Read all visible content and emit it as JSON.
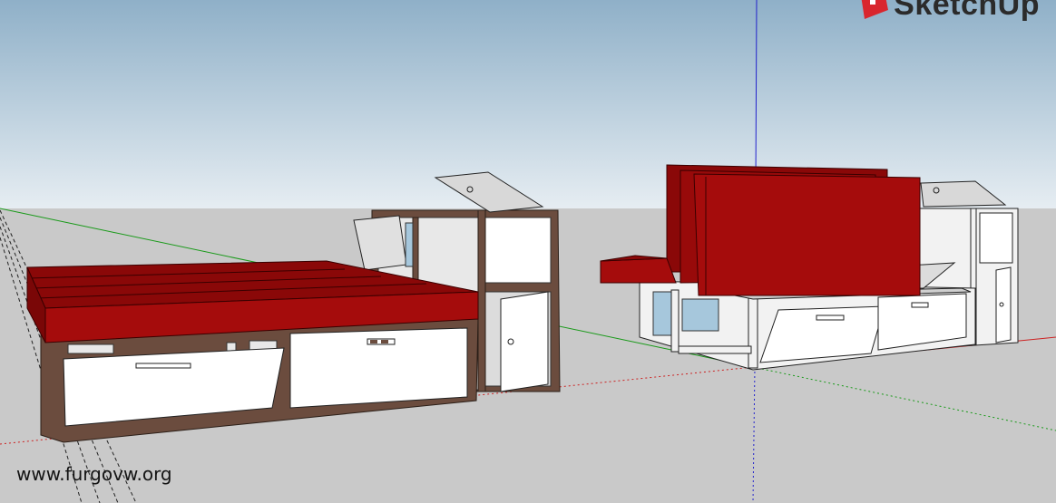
{
  "app": {
    "brand_name": "SketchUp",
    "brand_color": "#d9262e"
  },
  "viewport": {
    "sky_top_color": "#8fb0c8",
    "sky_bottom_color": "#e6edf2",
    "ground_color": "#c9c9c9",
    "axes": {
      "red_axis_color": "#cc2222",
      "green_axis_color": "#1a9a1a",
      "blue_axis_color": "#2222cc"
    }
  },
  "model": {
    "cushion_color": "#a50c0c",
    "frame_color_left": "#6b4c3e",
    "frame_color_right": "#f2f2f2",
    "drawer_color": "#ffffff"
  },
  "watermark": "www.furgovw.org"
}
